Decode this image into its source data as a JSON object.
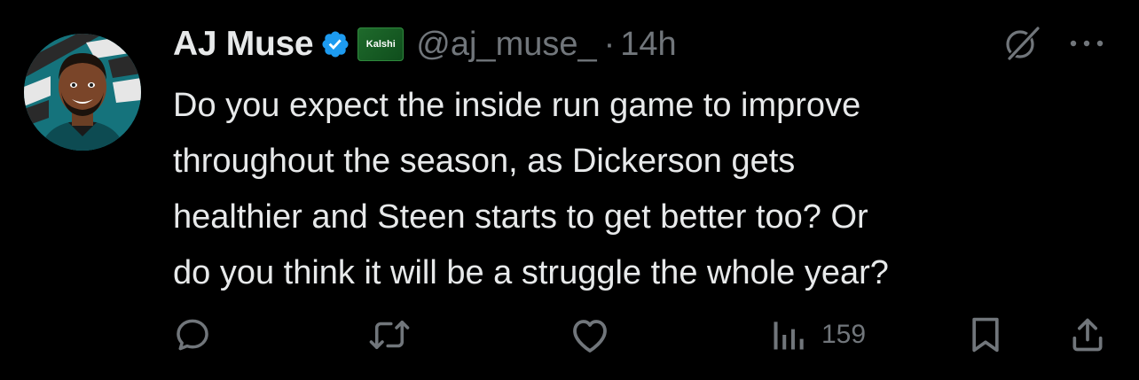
{
  "tweet": {
    "author": {
      "display_name": "AJ Muse",
      "handle": "@aj_muse_",
      "affiliate_label": "Kalshi",
      "verified": true
    },
    "separator": "·",
    "timestamp": "14h",
    "text": "Do you expect the inside run game to improve\nthroughout the season, as Dickerson gets\nhealthier and Steen starts to get better too? Or\ndo you think it will be a struggle the whole year?",
    "stats": {
      "views": "159"
    }
  },
  "icons": {
    "verified": "verified-badge-icon",
    "grok": "grok-icon",
    "more": "more-icon",
    "reply": "reply-icon",
    "retweet": "retweet-icon",
    "like": "like-icon",
    "views": "views-icon",
    "bookmark": "bookmark-icon",
    "share": "share-icon"
  },
  "colors": {
    "background": "#000000",
    "text_primary": "#e7e9ea",
    "text_secondary": "#71767b",
    "verified_blue": "#1d9bf0",
    "affiliate_green": "#1f6b2c"
  }
}
